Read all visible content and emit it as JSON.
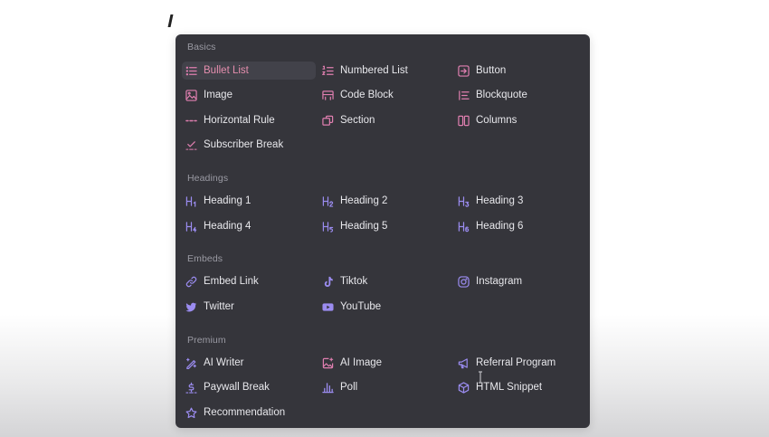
{
  "menu": {
    "sections": [
      {
        "label": "Basics",
        "items": [
          {
            "label": "Bullet List",
            "icon": "bullet-list-icon",
            "active": true
          },
          {
            "label": "Numbered List",
            "icon": "numbered-list-icon"
          },
          {
            "label": "Button",
            "icon": "button-icon"
          },
          {
            "label": "Image",
            "icon": "image-icon"
          },
          {
            "label": "Code Block",
            "icon": "code-block-icon"
          },
          {
            "label": "Blockquote",
            "icon": "blockquote-icon"
          },
          {
            "label": "Horizontal Rule",
            "icon": "horizontal-rule-icon"
          },
          {
            "label": "Section",
            "icon": "section-icon"
          },
          {
            "label": "Columns",
            "icon": "columns-icon"
          },
          {
            "label": "Subscriber Break",
            "icon": "subscriber-break-icon"
          }
        ]
      },
      {
        "label": "Headings",
        "items": [
          {
            "label": "Heading 1",
            "icon": "heading-1-icon"
          },
          {
            "label": "Heading 2",
            "icon": "heading-2-icon"
          },
          {
            "label": "Heading 3",
            "icon": "heading-3-icon"
          },
          {
            "label": "Heading 4",
            "icon": "heading-4-icon"
          },
          {
            "label": "Heading 5",
            "icon": "heading-5-icon"
          },
          {
            "label": "Heading 6",
            "icon": "heading-6-icon"
          }
        ]
      },
      {
        "label": "Embeds",
        "items": [
          {
            "label": "Embed Link",
            "icon": "link-icon"
          },
          {
            "label": "Tiktok",
            "icon": "tiktok-icon"
          },
          {
            "label": "Instagram",
            "icon": "instagram-icon"
          },
          {
            "label": "Twitter",
            "icon": "twitter-icon"
          },
          {
            "label": "YouTube",
            "icon": "youtube-icon"
          }
        ]
      },
      {
        "label": "Premium",
        "items": [
          {
            "label": "AI Writer",
            "icon": "ai-writer-icon"
          },
          {
            "label": "AI Image",
            "icon": "ai-image-icon"
          },
          {
            "label": "Referral Program",
            "icon": "megaphone-icon"
          },
          {
            "label": "Paywall Break",
            "icon": "dollar-icon"
          },
          {
            "label": "Poll",
            "icon": "poll-icon"
          },
          {
            "label": "HTML Snippet",
            "icon": "cube-icon"
          },
          {
            "label": "Recommendation",
            "icon": "star-icon"
          }
        ]
      }
    ]
  },
  "colors": {
    "menu_background": "#35353b",
    "active_item_background": "#42424a",
    "active_text": "#e58eae",
    "section_label": "#9a9aa3",
    "item_text": "#e8e8ec",
    "pink_icon": "#e07fb0",
    "purple_icon": "#9b8cf0"
  }
}
